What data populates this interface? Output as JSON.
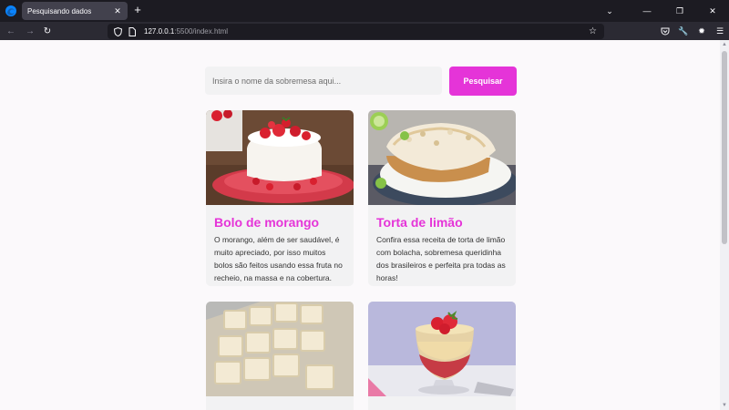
{
  "browser": {
    "tab_title": "Pesquisando dados",
    "url_host": "127.0.0.1",
    "url_rest": ":5500/index.html"
  },
  "search": {
    "placeholder": "Insira o nome da sobremesa aqui...",
    "button_label": "Pesquisar"
  },
  "cards": [
    {
      "title": "Bolo de morango",
      "description": "O morango, além de ser saudável, é muito apreciado, por isso muitos bolos são feitos usando essa fruta no recheio, na massa e na cobertura."
    },
    {
      "title": "Torta de limão",
      "description": "Confira essa receita de torta de limão com bolacha, sobremesa queridinha dos brasileiros e perfeita pra todas as horas!"
    },
    {
      "title": "",
      "description": ""
    },
    {
      "title": "",
      "description": ""
    }
  ],
  "colors": {
    "accent": "#e534d8",
    "card_bg": "#f2f2f3",
    "page_bg": "#fbf9fb"
  }
}
